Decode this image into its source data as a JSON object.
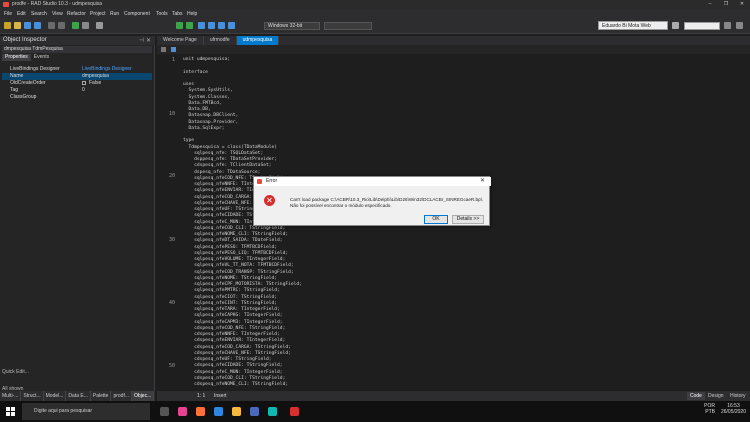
{
  "window": {
    "title": "prodfe - RAD Studio 10.3 - udmpesquisa",
    "buttons": [
      "–",
      "❐",
      "✕"
    ]
  },
  "menu": [
    "File",
    "Edit",
    "Search",
    "View",
    "Refactor",
    "Project",
    "Run",
    "Component",
    "Tools",
    "Tabs",
    "Help"
  ],
  "toolbar": {
    "platform": "Windows 32-bit",
    "login": "Eduardo Bi Mota Web"
  },
  "object_inspector": {
    "title": "Object Inspector",
    "component": "dmpesquisa  TdmPesquisa",
    "tabs": [
      "Properties",
      "Events"
    ],
    "properties": [
      {
        "name": "LiveBindings Designer",
        "value": "LiveBindings Designer"
      },
      {
        "name": "Name",
        "value": "dmpesquisa"
      },
      {
        "name": "OldCreateOrder",
        "value": "False"
      },
      {
        "name": "Tag",
        "value": "0"
      },
      {
        "name": "ClassGroup",
        "value": ""
      }
    ],
    "quick_edit": "Quick Edit...",
    "all_shown": "All shown"
  },
  "bottom_tabs": [
    "Multi-...",
    "Struct...",
    "Model...",
    "Data E...",
    "Palette",
    "prodf...",
    "Objec..."
  ],
  "editor": {
    "tabs": [
      "Welcome Page",
      "ufrmodfe",
      "udmpesquisa"
    ],
    "active_tab": 2,
    "line_numbers": [
      "1",
      "10",
      "20",
      "30",
      "40",
      "50"
    ],
    "code": [
      "unit udmpesquisa;",
      "",
      "interface",
      "",
      "uses",
      "  System.SysUtils,",
      "  System.Classes,",
      "  Data.FMTBcd,",
      "  Data.DB,",
      "  Datasnap.DBClient,",
      "  Datasnap.Provider,",
      "  Data.SqlExpr;",
      "",
      "type",
      "  Tdmpesquisa = class(TDataModule)",
      "    sqlpesq_nfe: TSQLDataSet;",
      "    dsppesq_nfe: TDataSetProvider;",
      "    cdspesq_nfe: TClientDataSet;",
      "    dspesq_nfe: TDataSource;",
      "    sqlpesq_nfeCOD_NFE: TStringField;",
      "    sqlpesq_nfeNNFE: TIntegerField;",
      "    sqlpesq_nfeENVIAR: TIntegerField;",
      "    sqlpesq_nfeCOD_CARGA: TIntegerField;",
      "    sqlpesq_nfeCHAVE_NFE: TStringField;",
      "    sqlpesq_nfeUF: TStringField;",
      "    sqlpesq_nfeCIDADE: TStringField;",
      "    sqlpesq_nfeC_MUN: TIntegerField;",
      "    sqlpesq_nfeCOD_CLI: TStringField;",
      "    sqlpesq_nfeNOME_CLI: TStringField;",
      "    sqlpesq_nfeDT_SAIDA: TDateField;",
      "    sqlpesq_nfePESO: TFMTBCDField;",
      "    sqlpesq_nfePESO_LIQ: TFMTBCDField;",
      "    sqlpesq_nfeVOLUME: TIntegerField;",
      "    sqlpesq_nfeVL_TT_NOTA: TFMTBCDField;",
      "    sqlpesq_nfeCOD_TRANSP: TStringField;",
      "    sqlpesq_nfeNOME: TStringField;",
      "    sqlpesq_nfeCPF_MOTORISTA: TStringField;",
      "    sqlpesq_nfePMTRC: TStringField;",
      "    sqlpesq_nfeCIOT: TStringField;",
      "    sqlpesq_nfeCINT: TStringField;",
      "    sqlpesq_nfeTARA: TIntegerField;",
      "    sqlpesq_nfeCAPKG: TIntegerField;",
      "    sqlpesq_nfeCAPM3: TIntegerField;",
      "    cdspesq_nfeCOD_NFE: TStringField;",
      "    cdspesq_nfeNNFE: TIntegerField;",
      "    cdspesq_nfeENVIAR: TIntegerField;",
      "    cdspesq_nfeCOD_CARGA: TStringField;",
      "    cdspesq_nfeCHAVE_NFE: TStringField;",
      "    cdspesq_nfeUF: TStringField;",
      "    cdspesq_nfeCIDADE: TStringField;",
      "    cdspesq_nfeC_MUN: TIntegerField;",
      "    cdspesq_nfeCOD_CLI: TStringField;",
      "    cdspesq_nfeNOME_CLI: TStringField;"
    ]
  },
  "status": {
    "position": "1: 1",
    "mode": "Insert",
    "view_tabs": [
      "Code",
      "Design",
      "History"
    ]
  },
  "dialog": {
    "title": "Error",
    "message_line1": "Can't load package C:\\ACBR\\10.3_Rio\\Lib\\Delphi\\Lib\\D26\\Win32\\DCLACBr_SINREGcaeR.bpl.",
    "message_line2": "Não foi possível encontrar o módulo especificado.",
    "ok": "OK",
    "details": "Details >>"
  },
  "taskbar": {
    "search_placeholder": "Digite aqui para pesquisar",
    "lang": "POR",
    "layout": "PTB",
    "time": "16:53",
    "date": "26/05/2020"
  }
}
